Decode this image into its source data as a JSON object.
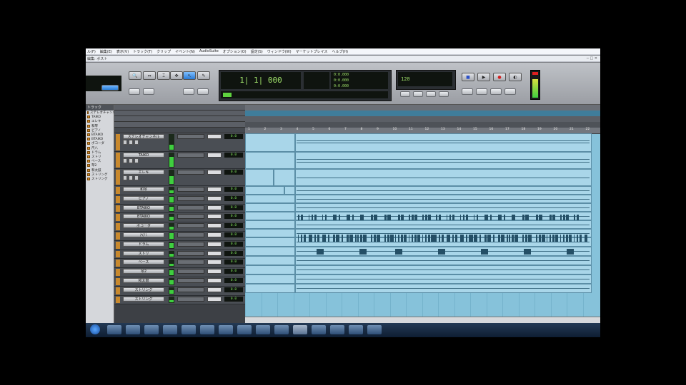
{
  "menu": [
    "ル(F)",
    "編集(E)",
    "表示(V)",
    "トラック(T)",
    "クリップ",
    "イベント(N)",
    "AudioSuite",
    "オプション(O)",
    "設定(S)",
    "ウィンドウ(W)",
    "マーケットプレイス",
    "ヘルプ(H)"
  ],
  "window": {
    "title": "編集: ボスト"
  },
  "transport": {
    "main_counter": "1| 1| 000",
    "secondary_values": [
      "0:0.000",
      "0:0.000",
      "0:0.000"
    ],
    "tempo": "120"
  },
  "sidebar": {
    "header": "トラック"
  },
  "tracks": [
    {
      "name": "ステレオチャンネル",
      "vol": "0.0"
    },
    {
      "name": "TAIKO",
      "vol": "0.0"
    },
    {
      "name": "エレキ",
      "vol": "0.0"
    },
    {
      "name": "和琴",
      "vol": "0.0"
    },
    {
      "name": "ピアノ",
      "vol": "0.0"
    },
    {
      "name": "BTAIKO",
      "vol": "0.0"
    },
    {
      "name": "BTAIKO",
      "vol": "0.0"
    },
    {
      "name": "ボコーダ",
      "vol": "0.0"
    },
    {
      "name": "尺八",
      "vol": "0.0"
    },
    {
      "name": "ドラム",
      "vol": "0.0"
    },
    {
      "name": "ストリ",
      "vol": "0.0"
    },
    {
      "name": "ベース",
      "vol": "0.0"
    },
    {
      "name": "琴2",
      "vol": "0.0"
    },
    {
      "name": "和太鼓",
      "vol": "0.0"
    },
    {
      "name": "ストリング",
      "vol": "0.0"
    },
    {
      "name": "ストリング",
      "vol": "0.0"
    }
  ],
  "colors": {
    "region": "#a9d6e9",
    "midi": "#244f66",
    "track_color": "#c9892d",
    "meter": "#3fcf3f"
  }
}
